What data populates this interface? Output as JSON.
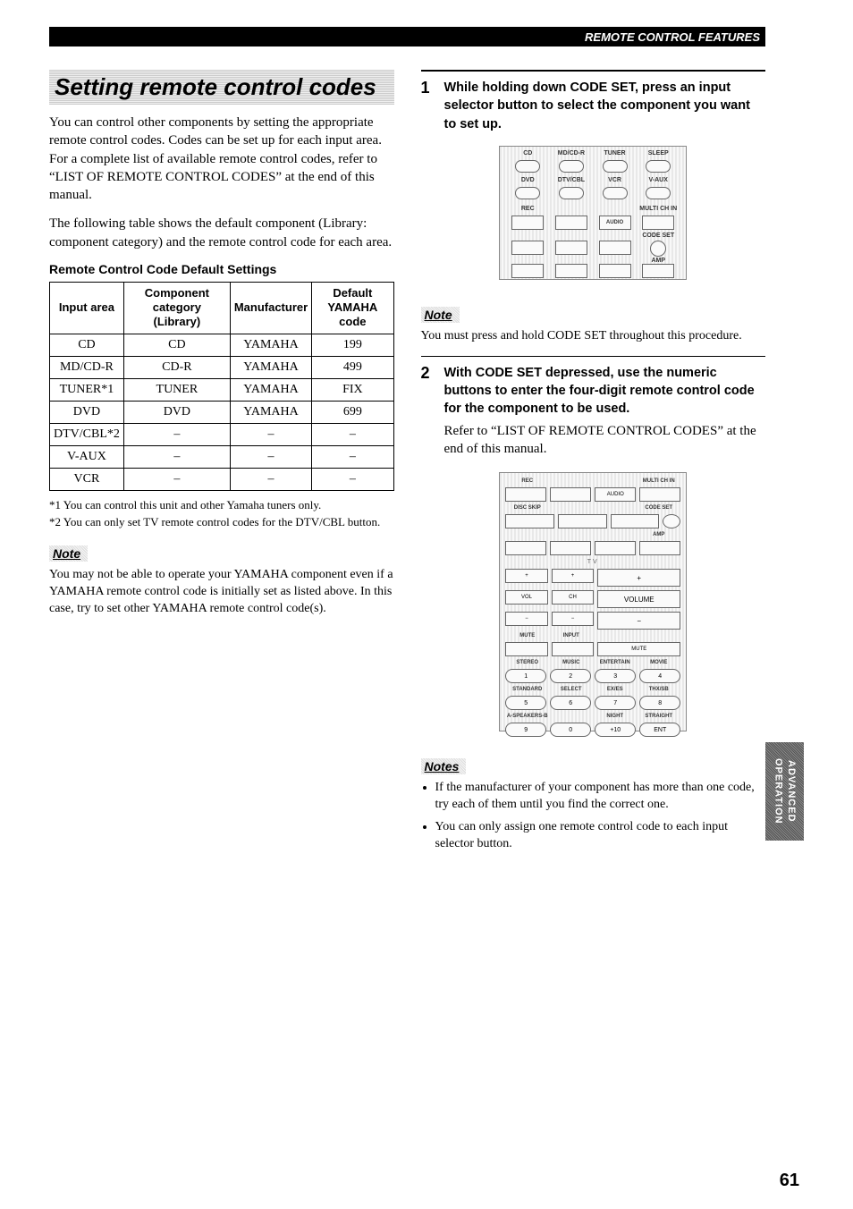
{
  "header": {
    "title": "REMOTE CONTROL FEATURES"
  },
  "side_tab": {
    "line1": "ADVANCED",
    "line2": "OPERATION"
  },
  "left": {
    "section_title": "Setting remote control codes",
    "intro_p1": "You can control other components by setting the appropriate remote control codes. Codes can be set up for each input area. For a complete list of available remote control codes, refer to “LIST OF REMOTE CONTROL CODES” at the end of this manual.",
    "intro_p2": "The following table shows the default component (Library: component category) and the remote control code for each area.",
    "table_title": "Remote Control Code Default Settings",
    "table": {
      "headers": [
        "Input area",
        "Component category (Library)",
        "Manufacturer",
        "Default YAMAHA code"
      ],
      "rows": [
        [
          "CD",
          "CD",
          "YAMAHA",
          "199"
        ],
        [
          "MD/CD-R",
          "CD-R",
          "YAMAHA",
          "499"
        ],
        [
          "TUNER*1",
          "TUNER",
          "YAMAHA",
          "FIX"
        ],
        [
          "DVD",
          "DVD",
          "YAMAHA",
          "699"
        ],
        [
          "DTV/CBL*2",
          "–",
          "–",
          "–"
        ],
        [
          "V-AUX",
          "–",
          "–",
          "–"
        ],
        [
          "VCR",
          "–",
          "–",
          "–"
        ]
      ]
    },
    "footnote1": "*1 You can control this unit and other Yamaha tuners only.",
    "footnote2": "*2 You can only set TV remote control codes for the DTV/CBL button.",
    "note_label": "Note",
    "note_text": "You may not be able to operate your YAMAHA component even if a YAMAHA remote control code is initially set as listed above. In this case, try to set other YAMAHA remote control code(s)."
  },
  "right": {
    "step1": {
      "num": "1",
      "head": "While holding down CODE SET, press an input selector button to select the component you want to set up.",
      "note_label": "Note",
      "note_text": "You must press and hold CODE SET throughout this procedure."
    },
    "remote_top": {
      "row1": [
        "CD",
        "MD/CD-R",
        "TUNER",
        "SLEEP"
      ],
      "row2": [
        "DVD",
        "DTV/CBL",
        "VCR",
        "V-AUX"
      ],
      "rec": "REC",
      "multi": "MULTI CH IN",
      "audio": "AUDIO",
      "codeset": "CODE SET",
      "amp": "AMP"
    },
    "step2": {
      "num": "2",
      "head": "With CODE SET depressed, use the numeric buttons to enter the four-digit remote control code for the component to be used.",
      "body": "Refer to “LIST OF REMOTE CONTROL CODES” at the end of this manual."
    },
    "remote_full": {
      "rec": "REC",
      "multi": "MULTI CH IN",
      "audio": "AUDIO",
      "disc_skip": "DISC SKIP",
      "codeset": "CODE SET",
      "amp": "AMP",
      "tv": "TV",
      "vol": "VOL",
      "ch": "CH",
      "volume": "VOLUME",
      "mute": "MUTE",
      "input": "INPUT",
      "mute2": "MUTE",
      "preset_row1": [
        "STEREO",
        "MUSIC",
        "ENTERTAIN",
        "MOVIE"
      ],
      "num_row1": [
        "1",
        "2",
        "3",
        "4"
      ],
      "preset_row2": [
        "STANDARD",
        "SELECT",
        "EX/ES",
        "THX/SB"
      ],
      "num_row2": [
        "5",
        "6",
        "7",
        "8"
      ],
      "preset_row3": [
        "A-SPEAKERS-B",
        "",
        "NIGHT",
        "STRAIGHT"
      ],
      "num_row3": [
        "9",
        "0",
        "+10",
        "ENT"
      ]
    },
    "notes_label": "Notes",
    "notes": [
      "If the manufacturer of your component has more than one code, try each of them until you find the correct one.",
      "You can only assign one remote control code to each input selector button."
    ]
  },
  "page_number": "61"
}
